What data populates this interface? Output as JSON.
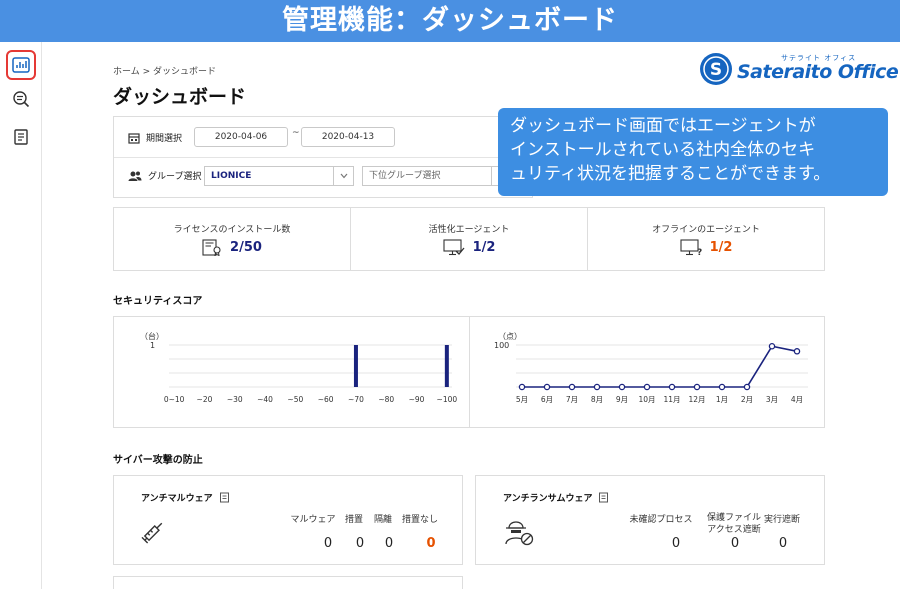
{
  "banner": {
    "title": "管理機能：ダッシュボード"
  },
  "breadcrumb": {
    "home": "ホーム",
    "separator": ">",
    "current": "ダッシュボード"
  },
  "page_title": "ダッシュボード",
  "logo": {
    "brand": "Sateraito Office",
    "kana": "サテライト オフィス"
  },
  "callout": {
    "line1": "ダッシュボード画面ではエージェントが",
    "line2": "インストールされている社内全体のセキ",
    "line3": "ュリティ状況を把握することができます。"
  },
  "filters": {
    "period_label": "期間選択",
    "date_from": "2020-04-06",
    "tilde": "~",
    "date_to": "2020-04-13",
    "group_label": "グループ選択",
    "group_value": "LIONICE",
    "subgroup_placeholder": "下位グループ選択"
  },
  "stats": [
    {
      "label": "ライセンスのインストール数",
      "value": "2/50",
      "icon": "license-icon"
    },
    {
      "label": "活性化エージェント",
      "value": "1/2",
      "icon": "monitor-check-icon"
    },
    {
      "label": "オフラインのエージェント",
      "value": "1/2",
      "icon": "monitor-question-icon"
    }
  ],
  "security_score": {
    "title": "セキュリティスコア"
  },
  "chart_data": [
    {
      "type": "bar",
      "ylabel": "（台）",
      "ylim": [
        0,
        1
      ],
      "yticks": [
        "1"
      ],
      "categories": [
        "0~10",
        "~20",
        "~30",
        "~40",
        "~50",
        "~60",
        "~70",
        "~80",
        "~90",
        "~100"
      ],
      "values": [
        0,
        0,
        0,
        0,
        0,
        0,
        1,
        0,
        0,
        1
      ],
      "grid": true
    },
    {
      "type": "line",
      "ylabel": "（点）",
      "ylim": [
        0,
        100
      ],
      "yticks": [
        "100"
      ],
      "categories": [
        "5月",
        "6月",
        "7月",
        "8月",
        "9月",
        "10月",
        "11月",
        "12月",
        "1月",
        "2月",
        "3月",
        "4月"
      ],
      "values": [
        0,
        0,
        0,
        0,
        0,
        0,
        0,
        0,
        0,
        0,
        97,
        85
      ],
      "grid": true
    }
  ],
  "cyber": {
    "title": "サイバー攻撃の防止"
  },
  "antimalware": {
    "title": "アンチマルウェア",
    "columns": [
      "マルウェア",
      "措置",
      "隔離",
      "措置なし"
    ],
    "values": [
      "0",
      "0",
      "0",
      "0"
    ]
  },
  "antiransom": {
    "title": "アンチランサムウェア",
    "columns": [
      "未確認プロセス",
      "保護ファイル\nアクセス遮断",
      "実行遮断"
    ],
    "values": [
      "0",
      "0",
      "0"
    ]
  },
  "colors": {
    "accent": "#1a237e",
    "warn": "#e65100",
    "banner": "#4a90e2",
    "callout": "#3d8ee2"
  }
}
